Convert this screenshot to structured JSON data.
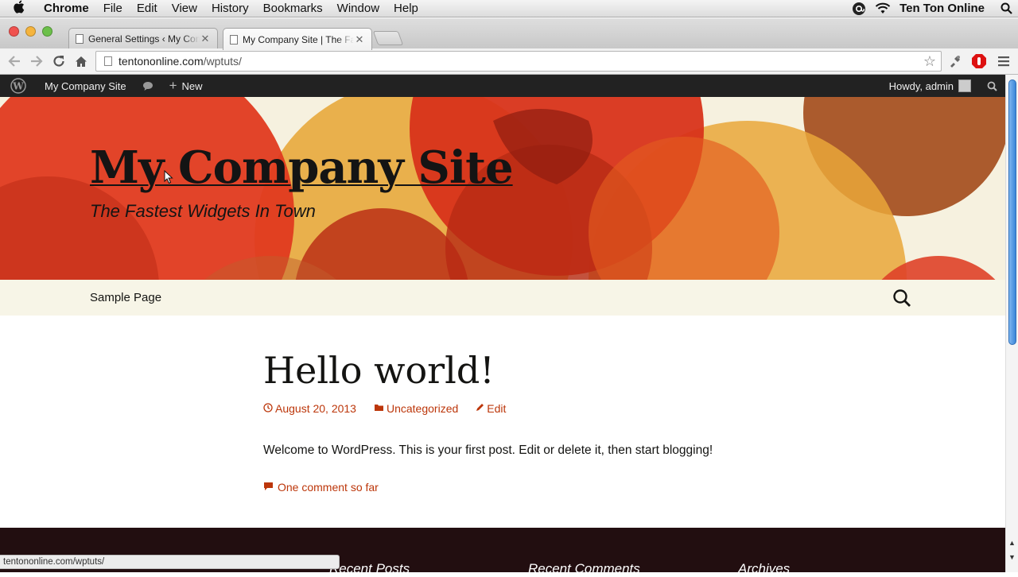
{
  "menubar": {
    "app_name": "Chrome",
    "items": [
      "File",
      "Edit",
      "View",
      "History",
      "Bookmarks",
      "Window",
      "Help"
    ],
    "user_name": "Ten Ton Online"
  },
  "tabs": [
    {
      "title": "General Settings ‹ My Company",
      "active": false
    },
    {
      "title": "My Company Site | The Fastest",
      "active": true
    }
  ],
  "omnibox": {
    "host": "tentononline.com",
    "path": "/wptuts/"
  },
  "adminbar": {
    "site_name": "My Company Site",
    "new_label": "New",
    "howdy": "Howdy, admin"
  },
  "site": {
    "title": "My Company Site",
    "description": "The Fastest Widgets In Town"
  },
  "nav": {
    "items": [
      "Sample Page"
    ]
  },
  "post": {
    "title": "Hello world!",
    "date": "August 20, 2013",
    "category": "Uncategorized",
    "edit": "Edit",
    "body": "Welcome to WordPress. This is your first post. Edit or delete it, then start blogging!",
    "comments": "One comment so far"
  },
  "footer": {
    "widgets": [
      "Recent Posts",
      "Recent Comments",
      "Archives"
    ]
  },
  "status_url": "tentononline.com/wptuts/",
  "colors": {
    "link": "#bc360a",
    "adminbar": "#222222",
    "footer": "#220e10",
    "nav_bg": "#f7f5e7"
  }
}
